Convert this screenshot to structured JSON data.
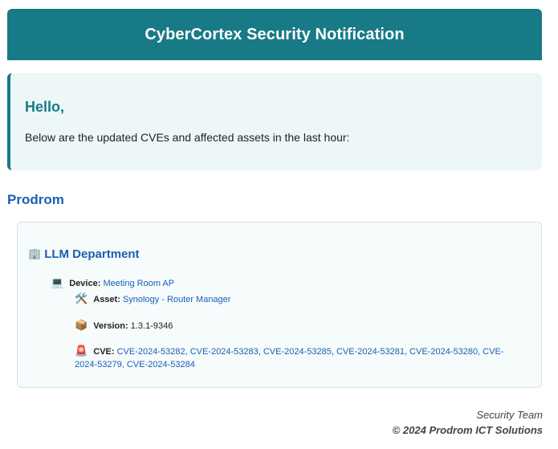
{
  "header": {
    "title": "CyberCortex Security Notification"
  },
  "greeting": {
    "heading": "Hello,",
    "message": "Below are the updated CVEs and affected assets in the last hour:"
  },
  "organization": {
    "name": "Prodrom"
  },
  "department": {
    "icon": "office-building-icon",
    "icon_glyph": "🏢",
    "name": "LLM Department",
    "device": {
      "icon": "laptop-icon",
      "icon_glyph": "💻",
      "label": "Device:",
      "value": "Meeting Room AP"
    },
    "asset": {
      "icon": "tools-icon",
      "icon_glyph": "🛠️",
      "label": "Asset:",
      "value": "Synology - Router Manager"
    },
    "version": {
      "icon": "package-icon",
      "icon_glyph": "📦",
      "label": "Version:",
      "value": "1.3.1-9346"
    },
    "cve": {
      "icon": "siren-icon",
      "icon_glyph": "🚨",
      "label": "CVE:",
      "value": "CVE-2024-53282, CVE-2024-53283, CVE-2024-53285, CVE-2024-53281, CVE-2024-53280, CVE-2024-53279, CVE-2024-53284"
    }
  },
  "footer": {
    "team": "Security Team",
    "copyright": "© 2024 Prodrom ICT Solutions"
  },
  "colors": {
    "brand_teal": "#177a86",
    "link_blue": "#1a5fb4",
    "panel_bg": "#eef7f8"
  }
}
